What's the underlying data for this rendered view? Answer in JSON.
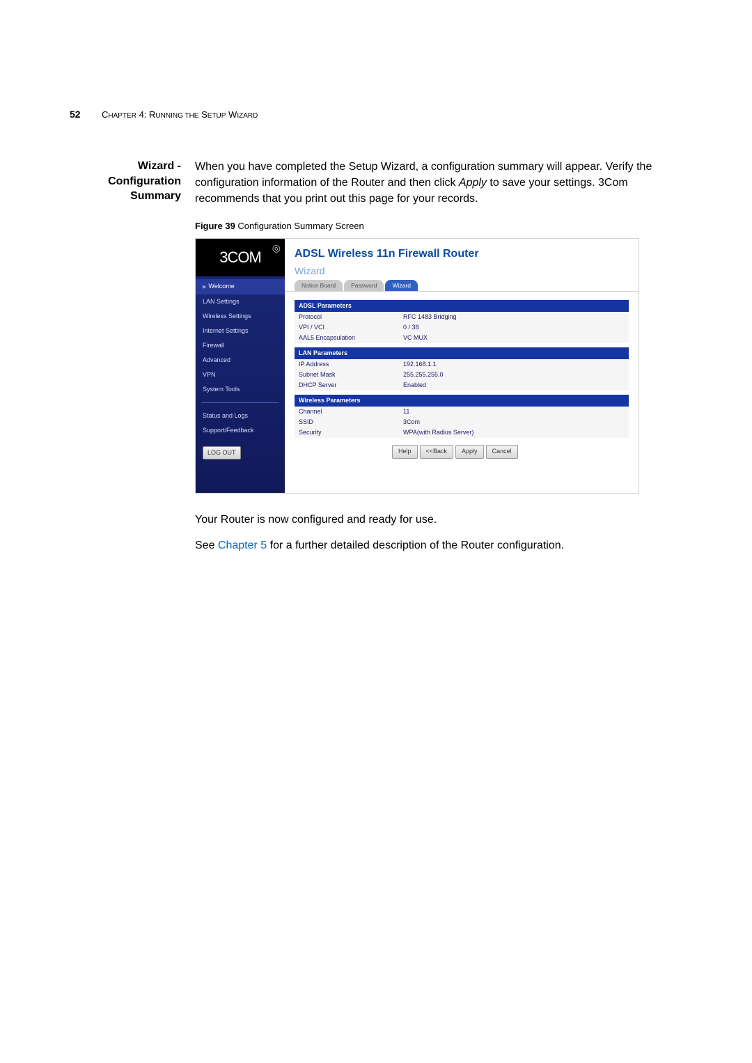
{
  "page_number": "52",
  "running_head_prefix": "C",
  "running_head_small": "HAPTER",
  "running_head_num": " 4: R",
  "running_head_small2": "UNNING THE",
  "running_head_mid": " S",
  "running_head_small3": "ETUP",
  "running_head_mid2": " W",
  "running_head_small4": "IZARD",
  "section_title_l1": "Wizard -",
  "section_title_l2": "Configuration",
  "section_title_l3": "Summary",
  "intro_text": "When you have completed the Setup Wizard, a configuration summary will appear. Verify the configuration information of the Router and then click ",
  "intro_apply": "Apply",
  "intro_text_tail": " to save your settings. 3Com recommends that you print out this page for your records.",
  "figure_label": "Figure 39",
  "figure_caption": "   Configuration Summary Screen",
  "router": {
    "logo": "3COM",
    "swirl": "◎",
    "title": "ADSL Wireless 11n Firewall Router",
    "subtitle": "Wizard",
    "tabs": [
      "Notice Board",
      "Password",
      "Wizard"
    ],
    "nav": [
      "Welcome",
      "LAN Settings",
      "Wireless Settings",
      "Internet Settings",
      "Firewall",
      "Advanced",
      "VPN",
      "System Tools"
    ],
    "nav2": [
      "Status and Logs",
      "Support/Feedback"
    ],
    "logout": "LOG OUT",
    "sections": [
      {
        "header": "ADSL Parameters",
        "rows": [
          [
            "Protocol",
            "RFC 1483 Bridging"
          ],
          [
            "VPI / VCI",
            "0 / 38"
          ],
          [
            "AAL5 Encapsulation",
            "VC MUX"
          ]
        ]
      },
      {
        "header": "LAN Parameters",
        "rows": [
          [
            "IP Address",
            "192.168.1.1"
          ],
          [
            "Subnet Mask",
            "255.255.255.0"
          ],
          [
            "DHCP Server",
            "Enabled"
          ]
        ]
      },
      {
        "header": "Wireless Parameters",
        "rows": [
          [
            "Channel",
            "11"
          ],
          [
            "SSID",
            "3Com"
          ],
          [
            "Security",
            "WPA(with Radius Server)"
          ]
        ]
      }
    ],
    "buttons": [
      "Help",
      "<<Back",
      "Apply",
      "Cancel"
    ]
  },
  "post1": "Your Router is now configured and ready for use.",
  "post2_pre": "See ",
  "post2_link": "Chapter 5",
  "post2_tail": " for a further detailed description of the Router configuration."
}
